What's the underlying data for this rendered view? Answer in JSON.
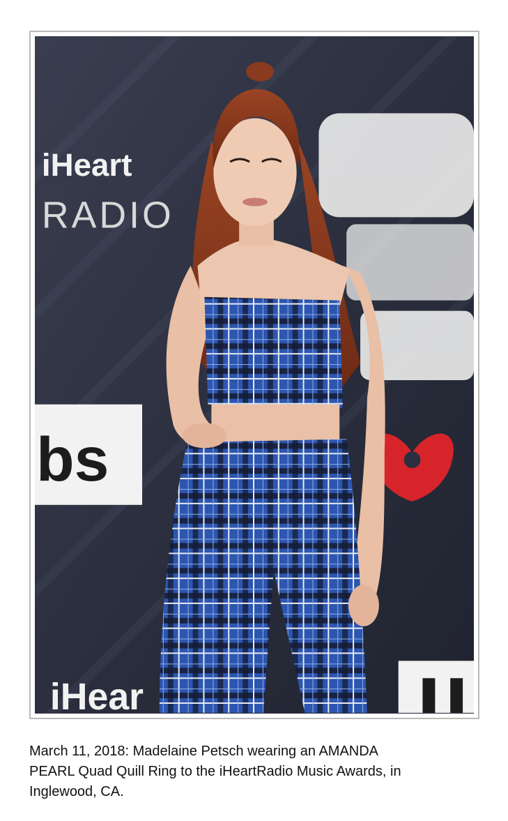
{
  "photo": {
    "backdrop_texts": {
      "brand_top": "iHeart",
      "brand_sub": "RADIO",
      "network_logo": "bs",
      "brand_bottom": "iHear"
    },
    "colors": {
      "backdrop": "#2d3140",
      "plaid_base": "#2d56b0",
      "plaid_dark": "#141a33",
      "hair": "#8a3a1e",
      "skin": "#e9bfa6",
      "iheart_red": "#d7242b"
    }
  },
  "caption": {
    "line1": "March 11, 2018: Madelaine Petsch wearing an AMANDA",
    "line2": "PEARL Quad Quill Ring to the iHeartRadio Music Awards, in",
    "line3": "Inglewood, CA."
  }
}
